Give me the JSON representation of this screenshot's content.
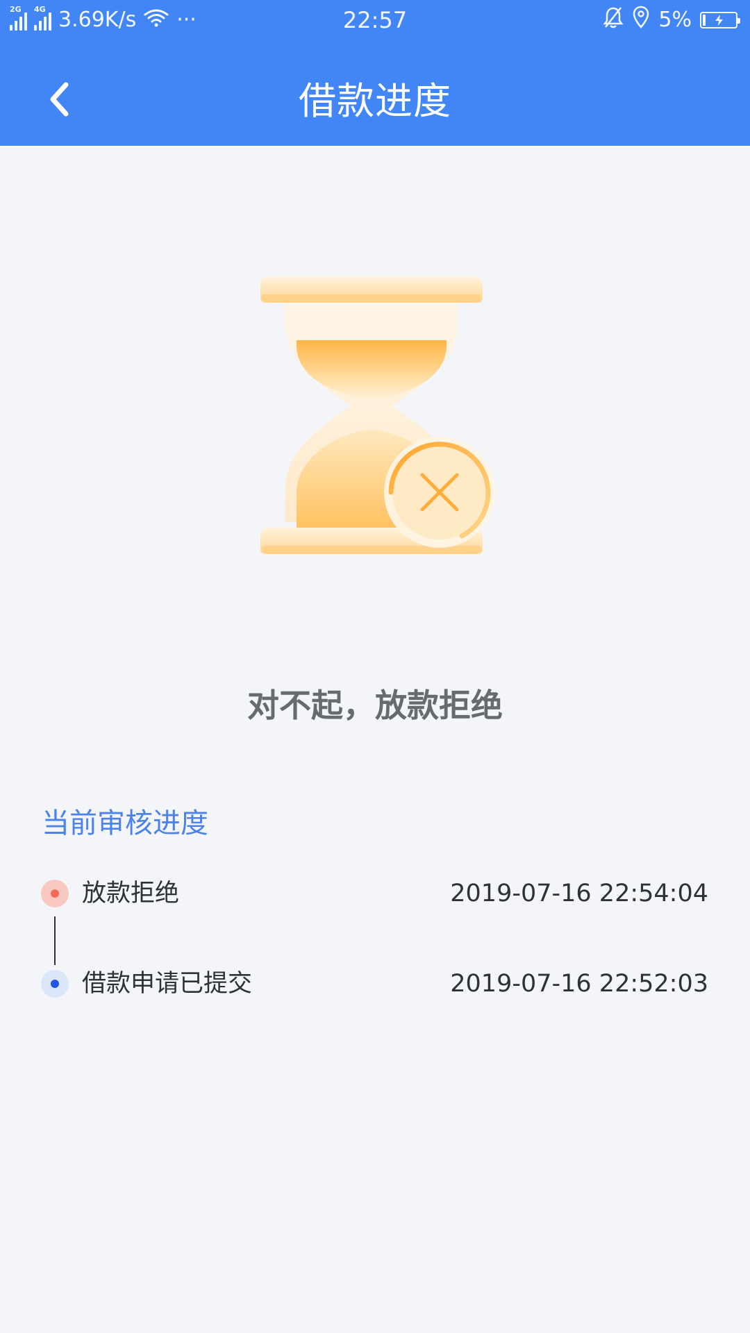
{
  "status_bar": {
    "sim1_label": "2G",
    "sim2_label": "4G",
    "speed": "3.69K/s",
    "more": "···",
    "time": "22:57",
    "battery": "5%"
  },
  "header": {
    "title": "借款进度"
  },
  "result": {
    "message": "对不起，放款拒绝"
  },
  "progress": {
    "section_title": "当前审核进度",
    "items": [
      {
        "label": "放款拒绝",
        "time": "2019-07-16 22:54:04",
        "dot_color": "#f26b57",
        "dot_bg": "#f9c9c1"
      },
      {
        "label": "借款申请已提交",
        "time": "2019-07-16 22:52:03",
        "dot_color": "#1f57e6",
        "dot_bg": "#dbe6fb"
      }
    ]
  },
  "colors": {
    "header_bg": "#4286f5",
    "page_bg": "#f3f5f9",
    "accent_text": "#4b83ea",
    "illustration_orange": "#ffb545"
  },
  "icons": {
    "back": "chevron-left-icon",
    "hourglass": "hourglass-icon",
    "reject": "close-circle-icon",
    "wifi": "wifi-icon",
    "alarm": "bell-off-icon",
    "location": "location-icon",
    "battery": "battery-charging-icon"
  }
}
